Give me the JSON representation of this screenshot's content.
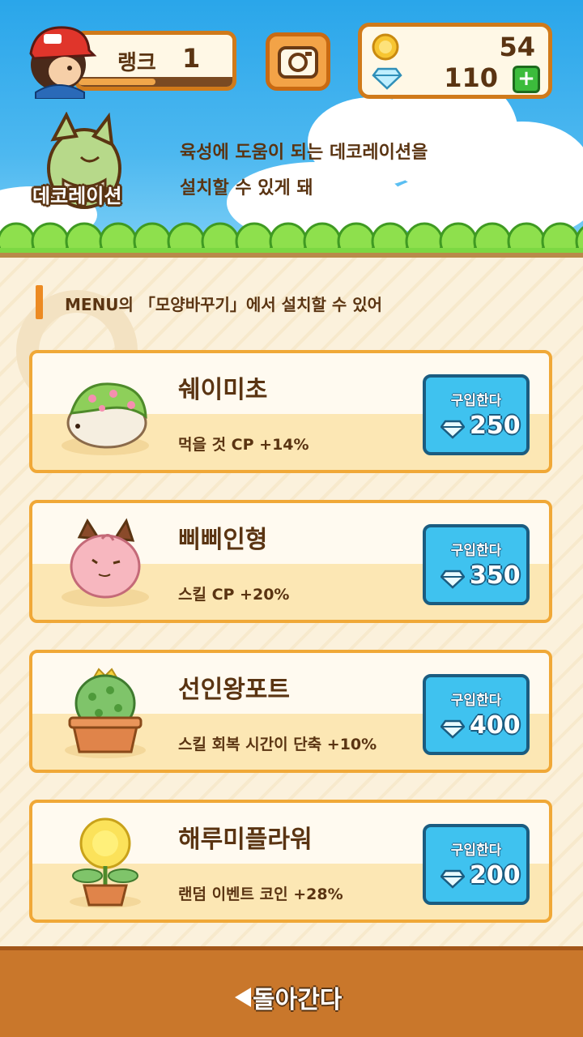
{
  "header": {
    "rank_label": "랭크",
    "rank_value": "1",
    "rank_progress": 0.5,
    "coins": "54",
    "diamonds": "110",
    "add_icon": "plus-icon",
    "camera_icon": "camera-icon"
  },
  "banner": {
    "icon_label": "데코레이션",
    "line1": "육성에 도움이 되는 데코레이션을",
    "line2": "설치할 수 있게 돼"
  },
  "info": {
    "text": "MENU의 「모양바꾸기」에서 설치할 수 있어"
  },
  "items": [
    {
      "name": "쉐이미초",
      "effect": "먹을 것 CP +14%",
      "buy_label": "구입한다",
      "price": "250",
      "icon": "shaymin-icon"
    },
    {
      "name": "삐삐인형",
      "effect": "스킬 CP +20%",
      "buy_label": "구입한다",
      "price": "350",
      "icon": "clefairy-doll-icon"
    },
    {
      "name": "선인왕포트",
      "effect": "스킬 회복 시간이 단축 +10%",
      "buy_label": "구입한다",
      "price": "400",
      "icon": "cactus-pot-icon"
    },
    {
      "name": "해루미플라워",
      "effect": "랜덤 이벤트 코인 +28%",
      "buy_label": "구입한다",
      "price": "200",
      "icon": "sunflower-pot-icon"
    }
  ],
  "footer": {
    "back_label": "돌아간다"
  },
  "colors": {
    "accent_orange": "#f0a837",
    "buy_blue": "#3fc2ef",
    "text_brown": "#5a3412"
  }
}
